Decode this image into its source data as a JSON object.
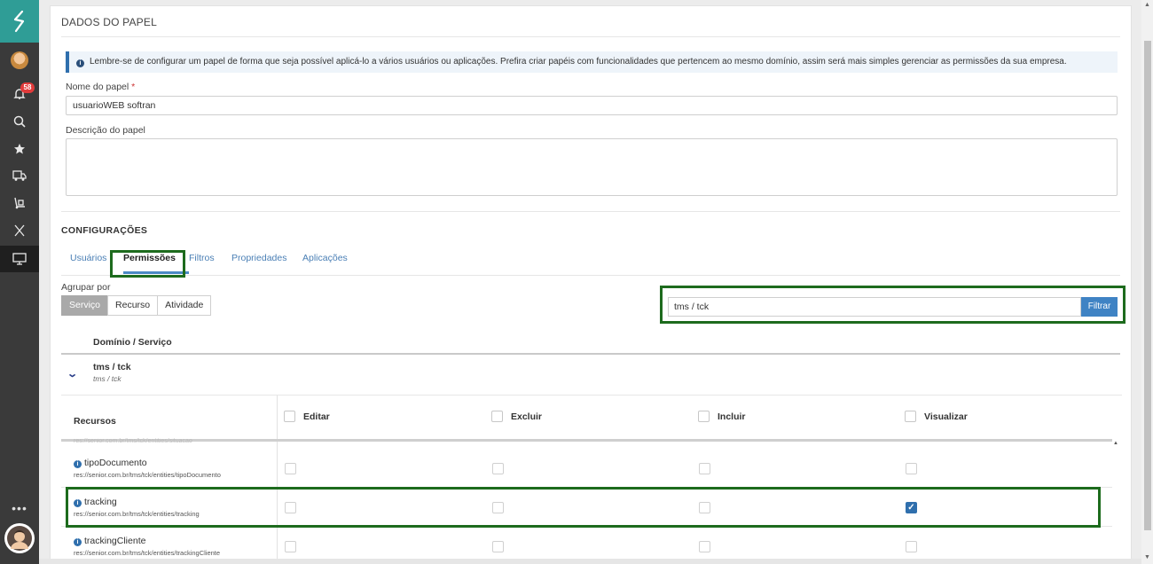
{
  "rail": {
    "notifications_count": "58",
    "items": [
      "avatar-top",
      "bell-icon",
      "search-icon",
      "star-icon",
      "truck-icon",
      "dolly-icon",
      "x-icon",
      "monitor-icon"
    ],
    "more": "•••"
  },
  "panel": {
    "title": "DADOS DO PAPEL",
    "info_text": "Lembre-se de configurar um papel de forma que seja possível aplicá-lo a vários usuários ou aplicações. Prefira criar papéis com funcionalidades que pertencem ao mesmo domínio, assim será mais simples gerenciar as permissões da sua empresa.",
    "name_label": "Nome do papel",
    "name_required": "*",
    "name_value": "usuarioWEB softran",
    "description_label": "Descrição do papel",
    "description_value": ""
  },
  "config": {
    "section_title": "CONFIGURAÇÕES",
    "tabs": [
      "Usuários",
      "Permissões",
      "Filtros",
      "Propriedades",
      "Aplicações"
    ],
    "active_tab": "Permissões",
    "group_by_label": "Agrupar por",
    "group_by_options": [
      "Serviço",
      "Recurso",
      "Atividade"
    ],
    "group_by_selected": "Serviço",
    "filter_value": "tms / tck",
    "filter_button": "Filtrar"
  },
  "domain": {
    "header": "Domínio / Serviço",
    "group_name": "tms / tck",
    "group_sub": "tms / tck"
  },
  "table": {
    "resources_header": "Recursos",
    "permissions": [
      "Editar",
      "Excluir",
      "Incluir",
      "Visualizar"
    ],
    "ghost_row": "res://senior.com.br/tms/tck/entities/situacao",
    "rows": [
      {
        "name": "tipoDocumento",
        "path": "res://senior.com.br/tms/tck/entities/tipoDocumento",
        "checked": [
          false,
          false,
          false,
          false
        ]
      },
      {
        "name": "tracking",
        "path": "res://senior.com.br/tms/tck/entities/tracking",
        "checked": [
          false,
          false,
          false,
          true
        ]
      },
      {
        "name": "trackingCliente",
        "path": "res://senior.com.br/tms/tck/entities/trackingCliente",
        "checked": [
          false,
          false,
          false,
          false
        ]
      }
    ]
  },
  "colors": {
    "brand": "#2f9d96",
    "accent": "#3f83c4",
    "highlight": "#1d6b1d",
    "badge": "#e23b3b"
  }
}
